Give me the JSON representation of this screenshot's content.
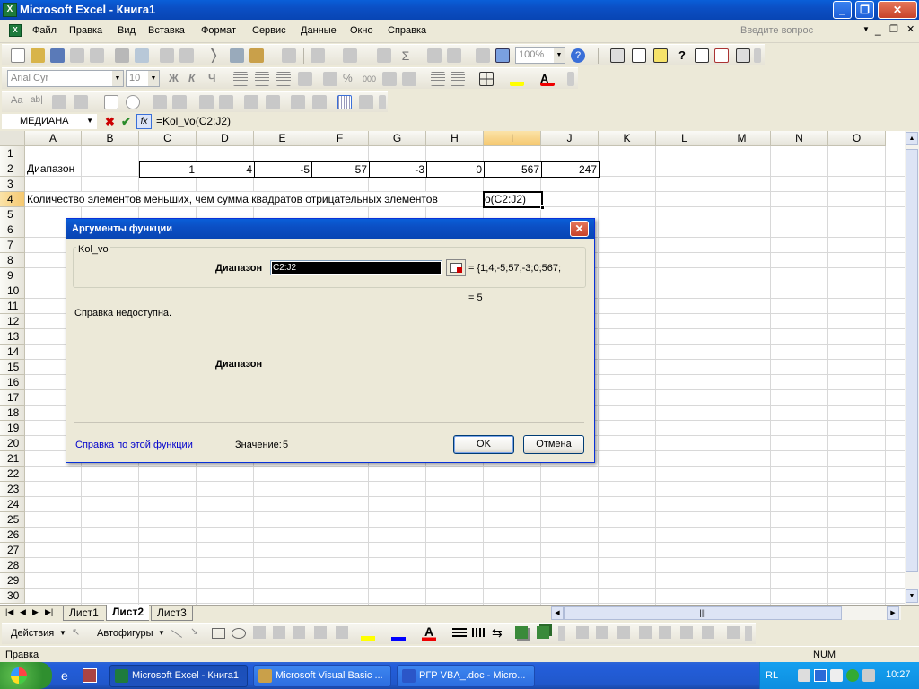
{
  "window": {
    "title": "Microsoft Excel - Книга1",
    "help_placeholder": "Введите вопрос"
  },
  "menu": [
    "Файл",
    "Правка",
    "Вид",
    "Вставка",
    "Формат",
    "Сервис",
    "Данные",
    "Окно",
    "Справка"
  ],
  "toolbar": {
    "zoom": "100%",
    "font": "Arial Cyr",
    "size": "10",
    "bold": "Ж",
    "italic": "К",
    "underline": "Ч"
  },
  "formula_bar": {
    "name_box": "МЕДИАНА",
    "formula": "=Kol_vo(C2:J2)",
    "cancel": "✖",
    "enter": "✔",
    "fx": "fx"
  },
  "columns": [
    "A",
    "B",
    "C",
    "D",
    "E",
    "F",
    "G",
    "H",
    "I",
    "J",
    "K",
    "L",
    "M",
    "N",
    "O"
  ],
  "rows": [
    "1",
    "2",
    "3",
    "4",
    "5",
    "6",
    "7",
    "8",
    "9",
    "10",
    "11",
    "12",
    "13",
    "14",
    "15",
    "16",
    "17",
    "18",
    "19",
    "20",
    "21",
    "22",
    "23",
    "24",
    "25",
    "26",
    "27",
    "28",
    "29",
    "30"
  ],
  "cells": {
    "A2": "Диапазон",
    "C2": "1",
    "D2": "4",
    "E2": "-5",
    "F2": "57",
    "G2": "-3",
    "H2": "0",
    "I2": "567",
    "J2": "247",
    "A4": "Количество элементов меньших, чем сумма квадратов отрицательных элементов",
    "I4": "o(C2:J2)"
  },
  "dialog": {
    "title": "Аргументы функции",
    "function_name": "Kol_vo",
    "arg_label": "Диапазон",
    "arg_value": "C2:J2",
    "arg_result": "= {1;4;-5;57;-3;0;567;",
    "result": "= 5",
    "help_text": "Справка недоступна.",
    "arg_desc_label": "Диапазон",
    "help_link": "Справка по этой функции",
    "value_label": "Значение:",
    "value": "5",
    "ok": "OK",
    "cancel": "Отмена"
  },
  "sheets": [
    "Лист1",
    "Лист2",
    "Лист3"
  ],
  "active_sheet": "Лист2",
  "drawing": {
    "actions": "Действия",
    "autoshapes": "Автофигуры"
  },
  "status": {
    "mode": "Правка",
    "num": "NUM"
  },
  "taskbar": {
    "tasks": [
      "Microsoft Excel - Книга1",
      "Microsoft Visual Basic ...",
      "РГР VBA_.doc - Micro..."
    ],
    "lang": "RL",
    "clock": "10:27"
  }
}
